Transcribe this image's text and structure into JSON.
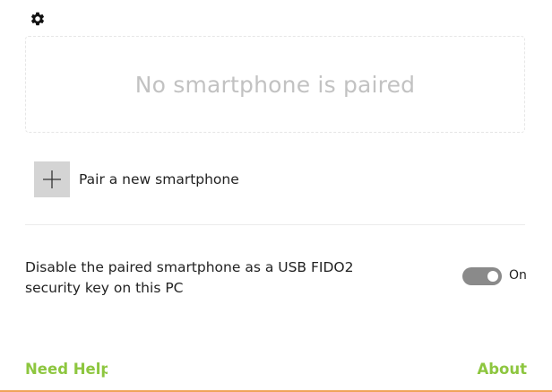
{
  "header": {
    "settings_icon": "gear-icon"
  },
  "paired_status": {
    "message": "No smartphone is paired"
  },
  "pair_action": {
    "icon": "plus-icon",
    "label": "Pair a new smartphone"
  },
  "usb_fido": {
    "description": "Disable the paired smartphone as a USB FIDO2 security key on this PC",
    "toggle_on": true,
    "toggle_state_label": "On"
  },
  "footer": {
    "need_help_label": "Need Help",
    "about_label": "About"
  },
  "colors": {
    "accent_green": "#8dc63f",
    "toggle_track": "#8a8a8a",
    "bottom_border": "#f0a35a",
    "placeholder_text": "#c2c2c2"
  }
}
